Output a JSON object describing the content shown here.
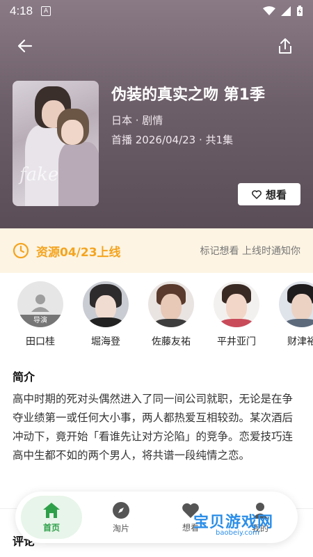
{
  "status_bar": {
    "time": "4:18",
    "notif": "A"
  },
  "header": {
    "back_icon": "arrow-left-icon",
    "share_icon": "share-icon"
  },
  "show": {
    "title": "伪装的真实之吻 第1季",
    "meta_line": "日本 · 剧情",
    "premiere_line": "首播 2026/04/23 · 共1集",
    "poster_text": "fake"
  },
  "want_button": {
    "label": "想看",
    "icon": "heart-outline-icon"
  },
  "banner": {
    "label": "资源04/23上线",
    "tip": "标记想看 上线时通知你",
    "icon": "clock-icon",
    "accent": "#f4a41f"
  },
  "cast": [
    {
      "name": "田口桂",
      "role": "导演",
      "avatar": "placeholder"
    },
    {
      "name": "堀海登",
      "role": ""
    },
    {
      "name": "佐藤友祐",
      "role": ""
    },
    {
      "name": "平井亚门",
      "role": ""
    },
    {
      "name": "财津裕",
      "role": ""
    }
  ],
  "intro": {
    "title": "简介",
    "text": "高中时期的死对头偶然进入了同一间公司就职，无论是在争夺业绩第一或任何大小事，两人都热爱互相较劲。某次酒后冲动下，竟开始「看谁先让对方沦陷」的竞争。恋爱技巧连高中生都不如的两个男人，将共谱一段纯情之恋。"
  },
  "comments": {
    "title": "评论"
  },
  "tabbar": {
    "tabs": [
      {
        "label": "首页",
        "icon": "home-icon",
        "active": true
      },
      {
        "label": "淘片",
        "icon": "compass-icon",
        "active": false
      },
      {
        "label": "想看",
        "icon": "heart-icon",
        "active": false
      },
      {
        "label": "我的",
        "icon": "user-icon",
        "active": false
      }
    ],
    "active_color": "#2ea04a"
  },
  "watermark": {
    "text": "宝贝游戏网",
    "url": "baobeiy.com"
  }
}
